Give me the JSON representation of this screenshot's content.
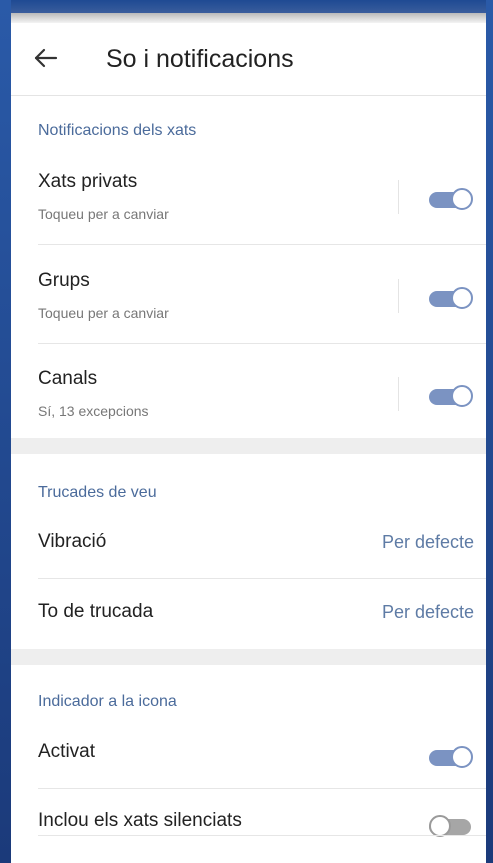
{
  "header": {
    "title": "So i notificacions",
    "back_icon": "arrow-left-icon"
  },
  "chat_notifications": {
    "section_title": "Notificacions dels xats",
    "items": [
      {
        "title": "Xats privats",
        "subtitle": "Toqueu per a canviar",
        "enabled": true
      },
      {
        "title": "Grups",
        "subtitle": "Toqueu per a canviar",
        "enabled": true
      },
      {
        "title": "Canals",
        "subtitle": "Sí, 13 excepcions",
        "enabled": true
      }
    ]
  },
  "voice_calls": {
    "section_title": "Trucades de veu",
    "items": [
      {
        "title": "Vibració",
        "value": "Per defecte"
      },
      {
        "title": "To de trucada",
        "value": "Per defecte"
      }
    ]
  },
  "badge": {
    "section_title": "Indicador a la icona",
    "items": [
      {
        "title": "Activat",
        "enabled": true
      },
      {
        "title": "Inclou els xats silenciats",
        "enabled": false
      }
    ]
  },
  "colors": {
    "accent": "#7b93c2",
    "section_title": "#4b6b9b",
    "value_text": "#5e7ba5",
    "background": "#ffffff",
    "gap": "#eeeeee"
  }
}
